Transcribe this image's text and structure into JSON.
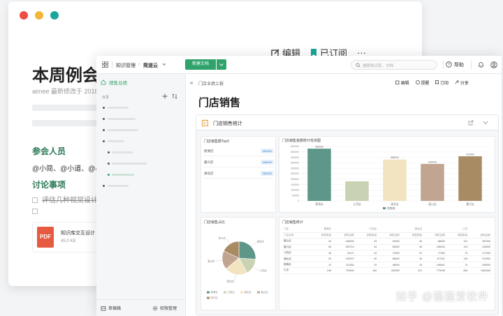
{
  "colors": {
    "accent": "#2fa36b",
    "teal_dot": "#1aa69a",
    "red_dot": "#ee4d45",
    "yellow_dot": "#f4b638",
    "heading_green": "#2d7a5a",
    "pdf_red": "#e55a40"
  },
  "back_doc": {
    "toolbar": {
      "edit": "编辑",
      "subscribed": "已订阅",
      "more": "···"
    },
    "title": "本周例会",
    "meta": "aimee 最新修改于 2018",
    "section_attendees": "参会人员",
    "attendees": "@小简、@小道、@小",
    "section_topics": "讨论事项",
    "task_done": "评估几种视觉设计",
    "attachment": {
      "badge": "PDF",
      "name": "知识库交互设计",
      "size": "45.0 KB"
    }
  },
  "topbar": {
    "breadcrumb_root": "知识管理",
    "breadcrumb_sep": "›",
    "breadcrumb_current": "简道云",
    "new_doc": "新建文档",
    "search_placeholder": "搜索知识库、文档",
    "help": "帮助"
  },
  "sidebar": {
    "section": "销售业绩",
    "dir_label": "目录",
    "bottom_left": "草稿箱",
    "bottom_right": "权限管理"
  },
  "main_header": {
    "breadcrumb": "门店业绩上报",
    "actions": {
      "edit": "编辑",
      "remind": "提醒",
      "subscribe": "订阅",
      "share": "分享"
    },
    "title": "门店销售",
    "embed_title": "门店销售统计"
  },
  "panels": {
    "summary": {
      "title": "门店销售额Top3",
      "rows": [
        {
          "name": "德清店",
          "badge": "483000"
        },
        {
          "name": "嘉兴店",
          "badge": "448000"
        },
        {
          "name": "湖北店",
          "badge": "380000"
        }
      ]
    },
    "pie_title": "门店销售占比",
    "table_title": "门店销售统计"
  },
  "chart_data": [
    {
      "type": "bar",
      "title": "门店销售金额统计柱状图",
      "categories": [
        "德清店",
        "江西店",
        "湖北店",
        "襄山店",
        "嘉兴店"
      ],
      "values": [
        480000,
        180000,
        380000,
        340000,
        410000
      ],
      "data_labels": [
        "483000",
        "",
        "388000",
        "340000",
        "413000"
      ],
      "ylim": [
        0,
        500000
      ],
      "yticks": [
        "0",
        "50000",
        "100000",
        "150000",
        "200000",
        "250000",
        "300000",
        "350000",
        "400000",
        "450000",
        "500000"
      ],
      "colors": [
        "#5e9689",
        "#c9d3b3",
        "#f3e4c1",
        "#c1a591",
        "#a98b63"
      ],
      "legend": "销售额"
    },
    {
      "type": "pie",
      "title": "门店销售占比",
      "labels": [
        "德清店",
        "江西店",
        "湖北店",
        "襄山店",
        "嘉兴店"
      ],
      "values": [
        26,
        16,
        22,
        18,
        18
      ],
      "colors": [
        "#5e9689",
        "#c9d3b3",
        "#f3e4c1",
        "#c1a591",
        "#a98b63"
      ]
    }
  ],
  "sales_table": {
    "header_groups": [
      "门店",
      "",
      "德清店",
      "",
      "江西店",
      "",
      "湖北店",
      "",
      "江苏"
    ],
    "header": [
      "门店名称",
      "",
      "销售数量",
      "销售金额",
      "销售数量",
      "销售金额",
      "销售数量",
      "销售金额",
      "销售数量",
      "销售金额"
    ],
    "rows": [
      [
        "襄山店",
        "",
        "24",
        "180000",
        "43",
        "92000",
        "40",
        "88000",
        "121",
        "187200"
      ],
      [
        "嘉兴店",
        "",
        "26",
        "202710",
        "44",
        "66000",
        "40",
        "208100",
        "119",
        "140000"
      ],
      [
        "江西店",
        "",
        "16",
        "31147",
        "44",
        "72000",
        "51",
        "77000",
        "70",
        "171000"
      ],
      [
        "湖北店",
        "",
        "20",
        "100472",
        "40",
        "88000",
        "40",
        "107111",
        "115",
        "211000"
      ],
      [
        "德清店",
        "",
        "12",
        "112000",
        "19",
        "98000",
        "10",
        "189941",
        "74",
        "159000"
      ],
      [
        "汇总",
        "",
        "316",
        "723000",
        "140",
        "300000",
        "221",
        "775198",
        "605",
        "1081000"
      ]
    ]
  },
  "watermark": "知乎 @猫猫爱软件"
}
